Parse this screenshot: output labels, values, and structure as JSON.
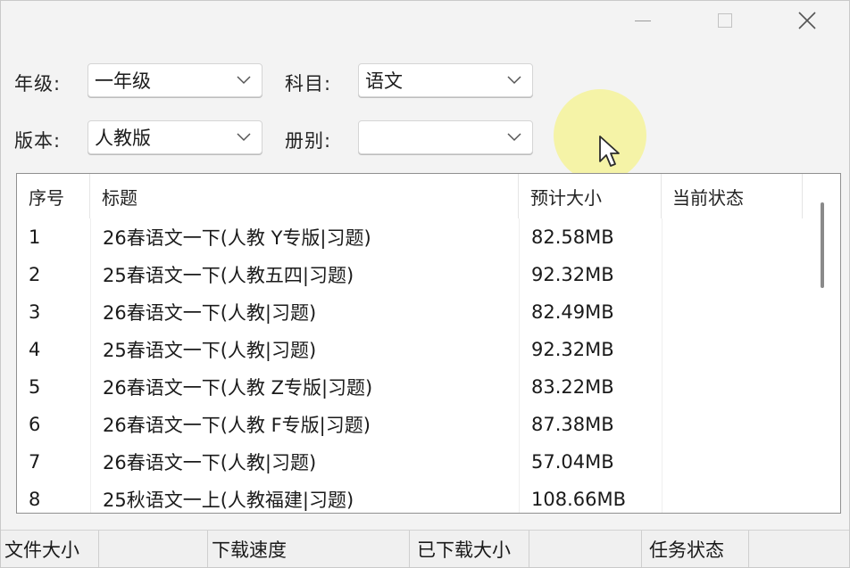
{
  "window": {
    "minimize_icon": "minimize-icon",
    "maximize_icon": "maximize-icon",
    "close_icon": "close-icon"
  },
  "filters": {
    "grade": {
      "label": "年级:",
      "value": "一年级"
    },
    "subject": {
      "label": "科目:",
      "value": "语文"
    },
    "edition": {
      "label": "版本:",
      "value": "人教版"
    },
    "volume": {
      "label": "册别:",
      "value": ""
    }
  },
  "table": {
    "columns": [
      "序号",
      "标题",
      "预计大小",
      "当前状态"
    ],
    "rows": [
      {
        "index": "1",
        "title": "26春语文一下(人教 Y专版|习题)",
        "size": "82.58MB",
        "status": ""
      },
      {
        "index": "2",
        "title": "25春语文一下(人教五四|习题)",
        "size": "92.32MB",
        "status": ""
      },
      {
        "index": "3",
        "title": "26春语文一下(人教|习题)",
        "size": "82.49MB",
        "status": ""
      },
      {
        "index": "4",
        "title": "25春语文一下(人教|习题)",
        "size": "92.32MB",
        "status": ""
      },
      {
        "index": "5",
        "title": "26春语文一下(人教 Z专版|习题)",
        "size": "83.22MB",
        "status": ""
      },
      {
        "index": "6",
        "title": "26春语文一下(人教 F专版|习题)",
        "size": "87.38MB",
        "status": ""
      },
      {
        "index": "7",
        "title": "26春语文一下(人教|习题)",
        "size": "57.04MB",
        "status": ""
      },
      {
        "index": "8",
        "title": "25秋语文一上(人教福建|习题)",
        "size": "108.66MB",
        "status": ""
      }
    ]
  },
  "statusbar": {
    "file_size": "文件大小",
    "download_speed": "下载速度",
    "downloaded_size": "已下载大小",
    "task_status": "任务状态"
  },
  "colors": {
    "window_bg": "#f3f3f3",
    "list_bg": "#ffffff",
    "cursor_highlight": "#f4f2a2"
  }
}
